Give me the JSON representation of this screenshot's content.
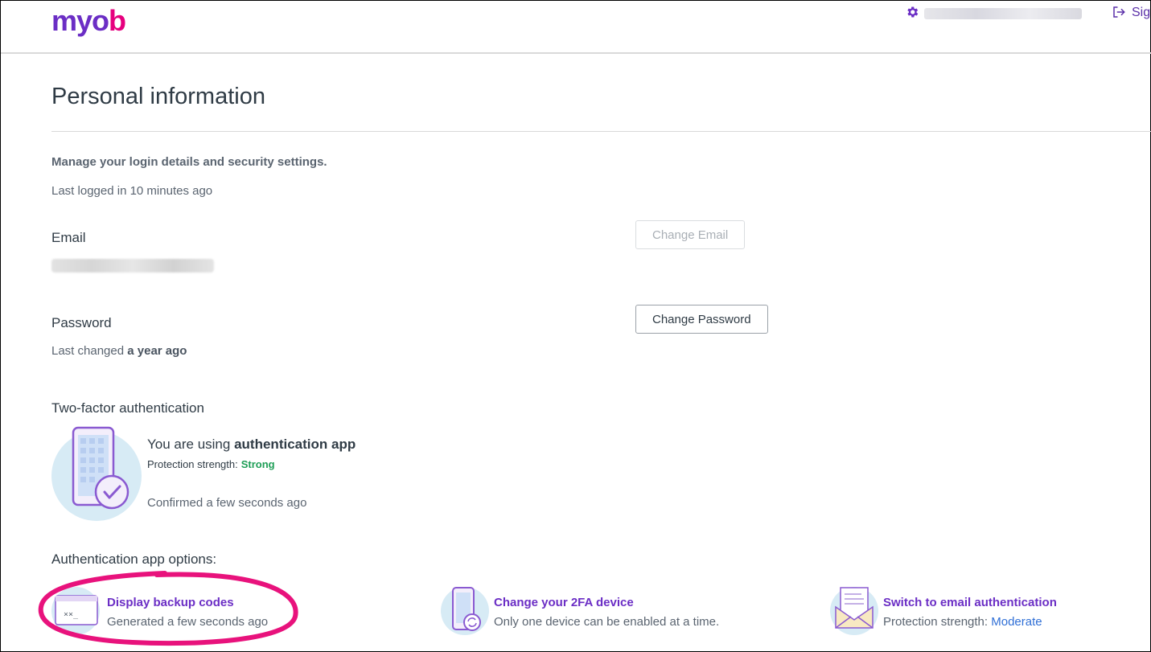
{
  "header": {
    "logo": {
      "part1": "myo",
      "part2": "b"
    },
    "signout_label": "Sig"
  },
  "page": {
    "title": "Personal information",
    "subtitle": "Manage your login details and security settings.",
    "last_logged_in": "Last logged in 10 minutes ago"
  },
  "email": {
    "label": "Email",
    "button": "Change Email"
  },
  "password": {
    "label": "Password",
    "changed_prefix": "Last changed",
    "changed_value": "a year ago",
    "button": "Change Password"
  },
  "two_factor": {
    "label": "Two-factor authentication",
    "using_prefix": "You are using",
    "using_method": "authentication app",
    "strength_label": "Protection strength:",
    "strength_value": "Strong",
    "confirmed": "Confirmed a few seconds ago"
  },
  "options": {
    "label": "Authentication app options:",
    "items": [
      {
        "title": "Display backup codes",
        "subtitle": "Generated a few seconds ago",
        "icon": "backup-codes-icon"
      },
      {
        "title": "Change your 2FA device",
        "subtitle": "Only one device can be enabled at a time.",
        "icon": "phone-sync-icon"
      },
      {
        "title": "Switch to email authentication",
        "subtitle_prefix": "Protection strength:",
        "subtitle_value": "Moderate",
        "icon": "envelope-icon"
      }
    ]
  },
  "colors": {
    "brand_purple": "#6b2ec5",
    "brand_pink": "#e6007e",
    "strong_green": "#1e9e56",
    "moderate_blue": "#2f6fd6",
    "highlight_pink": "#e8127c"
  }
}
